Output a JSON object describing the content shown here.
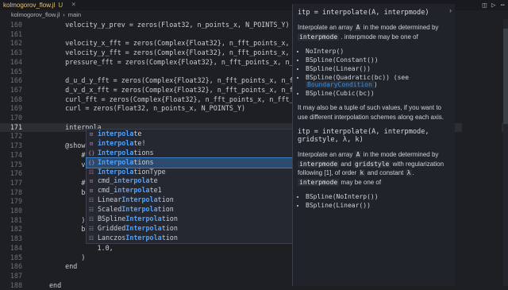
{
  "tab": {
    "filename": "kolmogorov_flow.jl",
    "status": "U"
  },
  "toolbar": {
    "icons": [
      "split-icon",
      "run-icon",
      "more-icon"
    ]
  },
  "breadcrumb": [
    "kolmogorov_flow.jl",
    "main"
  ],
  "editor": {
    "lines": [
      {
        "n": "160",
        "text": "    velocity_y_prev = zeros(Float32, n_points_x, N_POINTS_Y)"
      },
      {
        "n": "161",
        "text": ""
      },
      {
        "n": "162",
        "text": "    velocity_x_fft = zeros(Complex{Float32}, n_fft_points_x, n_f"
      },
      {
        "n": "163",
        "text": "    velocity_y_fft = zeros(Complex{Float32}, n_fft_points_x, n_f"
      },
      {
        "n": "164",
        "text": "    pressure_fft = zeros(Complex{Float32}, n_fft_points_x, n_fft"
      },
      {
        "n": "165",
        "text": ""
      },
      {
        "n": "166",
        "text": "    d_u_d_y_fft = zeros(Complex{Float32}, n_fft_points_x, n_fft_"
      },
      {
        "n": "167",
        "text": "    d_v_d_x_fft = zeros(Complex{Float32}, n_fft_points_x, n_fft_"
      },
      {
        "n": "168",
        "text": "    curl_fft = zeros(Complex{Float32}, n_fft_points_x, n_fft_poi"
      },
      {
        "n": "169",
        "text": "    curl = zeros(Float32, n_points_x, N_POINTS_Y)"
      },
      {
        "n": "170",
        "text": ""
      },
      {
        "n": "171",
        "text": "    interpola"
      },
      {
        "n": "172",
        "text": ""
      },
      {
        "n": "173",
        "text": "    @showprog"
      },
      {
        "n": "174",
        "text": "        # (1)"
      },
      {
        "n": "175",
        "text": "        veloc"
      },
      {
        "n": "176",
        "text": ""
      },
      {
        "n": "177",
        "text": "        # (2)"
      },
      {
        "n": "178",
        "text": "        backt"
      },
      {
        "n": "179",
        "text": "            c"
      },
      {
        "n": "180",
        "text": "            v"
      },
      {
        "n": "181",
        "text": "        )"
      },
      {
        "n": "182",
        "text": "        backt"
      },
      {
        "n": "183",
        "text": "            c"
      },
      {
        "n": "184",
        "text": "            1.0,"
      },
      {
        "n": "185",
        "text": "        )"
      },
      {
        "n": "186",
        "text": "    end"
      },
      {
        "n": "187",
        "text": ""
      },
      {
        "n": "188",
        "text": "end"
      }
    ]
  },
  "autocomplete": {
    "items": [
      {
        "icon": "variable-icon",
        "pre": "",
        "match": "interpola",
        "post": "te"
      },
      {
        "icon": "variable-icon",
        "pre": "",
        "match": "interpola",
        "post": "te!"
      },
      {
        "icon": "module-icon",
        "pre": "",
        "match": "Interpola",
        "post": "tions"
      },
      {
        "icon": "module-icon",
        "pre": "",
        "match": "Interpola",
        "post": "tions"
      },
      {
        "icon": "struct-icon",
        "pre": "",
        "match": "Interpola",
        "post": "tionType"
      },
      {
        "icon": "variable-icon",
        "pre": "cmd_",
        "match": "interpola",
        "post": "te"
      },
      {
        "icon": "variable-icon",
        "pre": "cmd_",
        "match": "interpola",
        "post": "te1"
      },
      {
        "icon": "struct-icon",
        "pre": "Linear",
        "match": "Interpola",
        "post": "tion"
      },
      {
        "icon": "struct-icon",
        "pre": "Scaled",
        "match": "Interpola",
        "post": "tion"
      },
      {
        "icon": "struct-icon",
        "pre": "BSpline",
        "match": "Interpola",
        "post": "tion"
      },
      {
        "icon": "struct-icon",
        "pre": "Gridded",
        "match": "Interpola",
        "post": "tion"
      },
      {
        "icon": "struct-icon",
        "pre": "Lanczos",
        "match": "Interpola",
        "post": "tion"
      }
    ],
    "selected_index": 3
  },
  "hover": {
    "signature1": "itp = interpolate(A, interpmode)",
    "p1a": "Interpolate an array",
    "p1_A": "A",
    "p1b": "in the mode determined by",
    "p1_mode": "interpmode",
    "p1c": ". interpmode may be one of",
    "list1": [
      "NoInterp()",
      "BSpline(Constant())",
      "BSpline(Linear())",
      "BSpline(Quadratic(bc)) (see",
      "BoundaryCondition",
      ")",
      "BSpline(Cubic(bc))"
    ],
    "p2": "It may also be a tuple of such values, if you want to use different interpolation schemes along each axis.",
    "signature2": "itp = interpolate(A, interpmode, gridstyle, λ, k)",
    "p3a": "Interpolate an array",
    "p3_A": "A",
    "p3b": "in the mode determined by",
    "p3_mode": "interpmode",
    "p3c": "and",
    "p3_grid": "gridstyle",
    "p3d": "with regularization following [1], of order",
    "p3_k": "k",
    "p3e": "and constant",
    "p3_l": "λ",
    "p3f": ".",
    "p3_mode2": "interpmode",
    "p3g": "may be one of",
    "list2": [
      "BSpline(NoInterp())",
      "BSpline(Linear())"
    ]
  }
}
